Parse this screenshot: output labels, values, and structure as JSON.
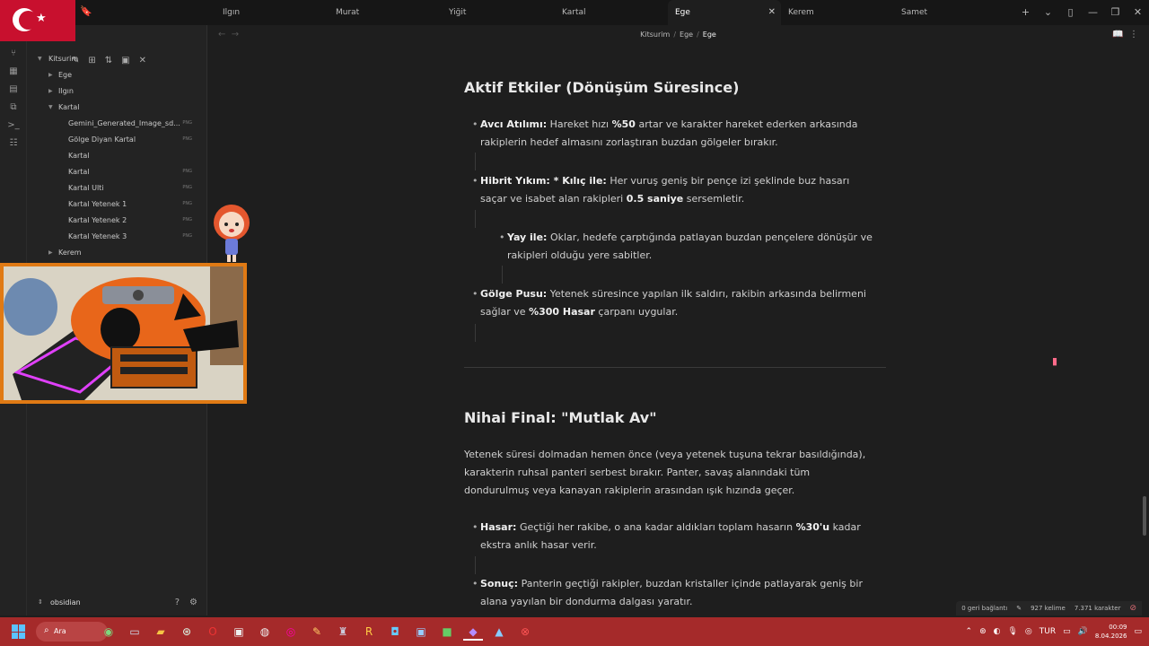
{
  "tabs": [
    {
      "label": "Ilgın",
      "active": false
    },
    {
      "label": "Murat",
      "active": false
    },
    {
      "label": "Yiğit",
      "active": false
    },
    {
      "label": "Kartal",
      "active": false
    },
    {
      "label": "Ege",
      "active": true
    },
    {
      "label": "Kerem",
      "active": false
    },
    {
      "label": "Samet",
      "active": false
    }
  ],
  "breadcrumb": {
    "root": "Kitsurim",
    "folder": "Ege",
    "current": "Ege"
  },
  "sidebar": {
    "vault_root": "Kitsurim",
    "items": [
      {
        "label": "Ege",
        "ext": ""
      },
      {
        "label": "Ilgın",
        "ext": ""
      },
      {
        "label": "Kartal",
        "ext": ""
      },
      {
        "label": "Gemini_Generated_Image_sd...",
        "ext": "PNG"
      },
      {
        "label": "Gölge Diyan Kartal",
        "ext": "PNG"
      },
      {
        "label": "Kartal",
        "ext": ""
      },
      {
        "label": "Kartal",
        "ext": "PNG"
      },
      {
        "label": "Kartal Ulti",
        "ext": "PNG"
      },
      {
        "label": "Kartal Yetenek 1",
        "ext": "PNG"
      },
      {
        "label": "Kartal Yetenek 2",
        "ext": "PNG"
      },
      {
        "label": "Kartal Yetenek 3",
        "ext": "PNG"
      },
      {
        "label": "Kerem",
        "ext": ""
      }
    ],
    "vault_name": "obsidian"
  },
  "doc": {
    "h_active": "Aktif Etkiler (Dönüşüm Süresince)",
    "b1_label": "Avcı Atılımı:",
    "b1_text1": "Hareket hızı",
    "b1_bold": "%50",
    "b1_text2": "artar ve karakter hareket ederken arkasında rakiplerin hedef almasını zorlaştıran buzdan gölgeler bırakır.",
    "b2_label": "Hibrit Yıkım: * Kılıç ile:",
    "b2_text1": "Her vuruş geniş bir pençe izi şeklinde buz hasarı saçar ve isabet alan rakipleri",
    "b2_bold": "0.5 saniye",
    "b2_text2": "sersemletir.",
    "b3_label": "Yay ile:",
    "b3_text": "Oklar, hedefe çarptığında patlayan buzdan pençelere dönüşür ve rakipleri olduğu yere sabitler.",
    "b4_label": "Gölge Pusu:",
    "b4_text1": "Yetenek süresince yapılan ilk saldırı, rakibin arkasında belirmeni sağlar ve",
    "b4_bold": "%300 Hasar",
    "b4_text2": "çarpanı uygular.",
    "h_final": "Nihai Final: \"Mutlak Av\"",
    "p_final": "Yetenek süresi dolmadan hemen önce (veya yetenek tuşuna tekrar basıldığında), karakterin ruhsal panteri serbest bırakır. Panter, savaş alanındaki tüm dondurulmuş veya kanayan rakiplerin arasından ışık hızında geçer.",
    "b5_label": "Hasar:",
    "b5_text1": "Geçtiği her rakibe, o ana kadar aldıkları toplam hasarın",
    "b5_bold": "%30'u",
    "b5_text2": "kadar ekstra anlık hasar verir.",
    "b6_label": "Sonuç:",
    "b6_text": "Panterin geçtiği rakipler, buzdan kristaller içinde patlayarak geniş bir alana yayılan bir dondurma dalgası yaratır."
  },
  "status": {
    "backlinks": "0 geri bağlantı",
    "words": "927 kelime",
    "chars": "7.371 karakter"
  },
  "taskbar": {
    "search": "Ara",
    "lang": "TUR",
    "time": "00:09",
    "date": "8.04.2026"
  },
  "colors": {
    "accent": "#e07a14",
    "taskbar": "#a52a2a",
    "flag": "#c8102e"
  }
}
